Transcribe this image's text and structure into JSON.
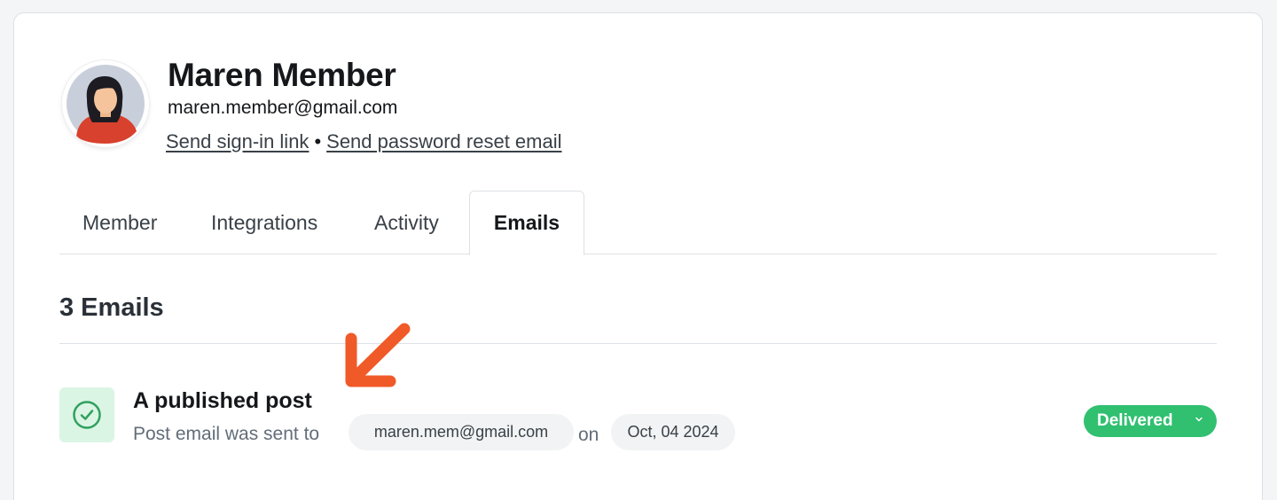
{
  "member": {
    "name": "Maren Member",
    "email": "maren.member@gmail.com",
    "sign_in_link": "Send sign-in link",
    "separator": "•",
    "password_reset": "Send password reset email"
  },
  "tabs": [
    {
      "label": "Member",
      "active": false
    },
    {
      "label": "Integrations",
      "active": false
    },
    {
      "label": "Activity",
      "active": false
    },
    {
      "label": "Emails",
      "active": true
    }
  ],
  "emails_section": {
    "title": "3 Emails",
    "items": [
      {
        "title": "A published post",
        "description": "Post email was sent to",
        "recipient": "maren.mem@gmail.com",
        "on_word": "on",
        "date": "Oct, 04 2024",
        "status": "Delivered",
        "status_icon": "check-circle-icon"
      }
    ]
  },
  "colors": {
    "accent_green": "#30c070",
    "check_bg": "#dbf5e4",
    "annotation_arrow": "#f05a28"
  }
}
